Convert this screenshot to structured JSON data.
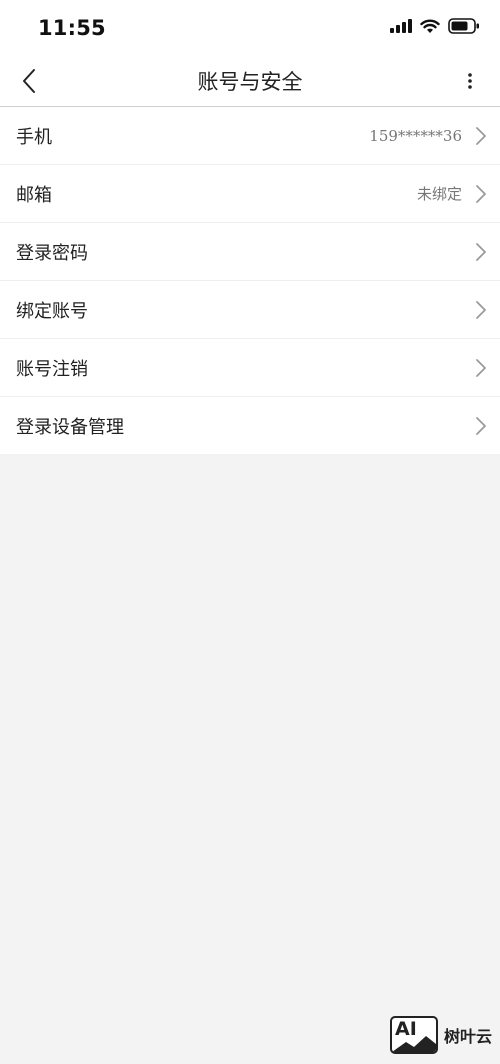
{
  "status_bar": {
    "time": "11:55",
    "icons": [
      "cellular-signal-icon",
      "wifi-icon",
      "battery-icon"
    ]
  },
  "nav": {
    "title": "账号与安全",
    "back_icon": "chevron-left-icon",
    "more_icon": "more-vertical-icon"
  },
  "settings": {
    "items": [
      {
        "label": "手机",
        "value": "159******36"
      },
      {
        "label": "邮箱",
        "value": "未绑定"
      },
      {
        "label": "登录密码",
        "value": ""
      },
      {
        "label": "绑定账号",
        "value": ""
      },
      {
        "label": "账号注销",
        "value": ""
      },
      {
        "label": "登录设备管理",
        "value": ""
      }
    ]
  },
  "watermark": {
    "logo_text": "AI",
    "brand": "树叶云"
  },
  "colors": {
    "background": "#f3f3f3",
    "surface": "#ffffff",
    "text": "#222222",
    "secondary_text": "#777777",
    "chevron": "#9a9a9a",
    "divider": "#efefef"
  }
}
